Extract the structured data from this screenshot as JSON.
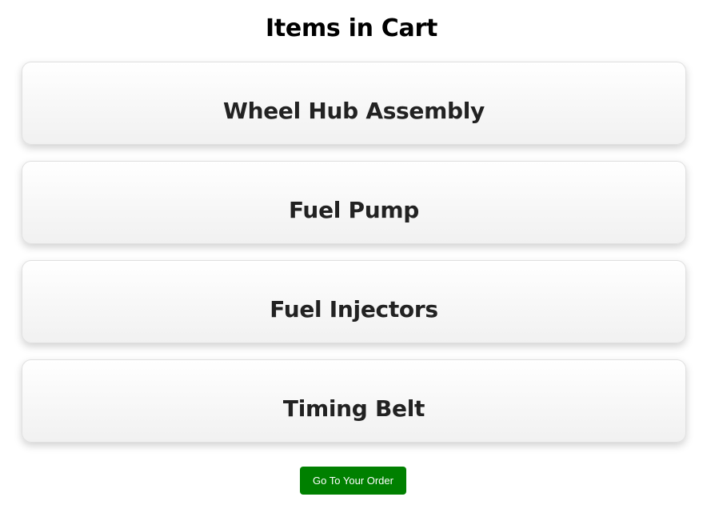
{
  "page": {
    "title": "Items in Cart"
  },
  "cart": {
    "items": [
      {
        "name": "Wheel Hub Assembly"
      },
      {
        "name": "Fuel Pump"
      },
      {
        "name": "Fuel Injectors"
      },
      {
        "name": "Timing Belt"
      }
    ]
  },
  "actions": {
    "order_label": "Go To Your Order"
  },
  "colors": {
    "accent": "#008000",
    "text": "#222222",
    "title": "#000000"
  }
}
